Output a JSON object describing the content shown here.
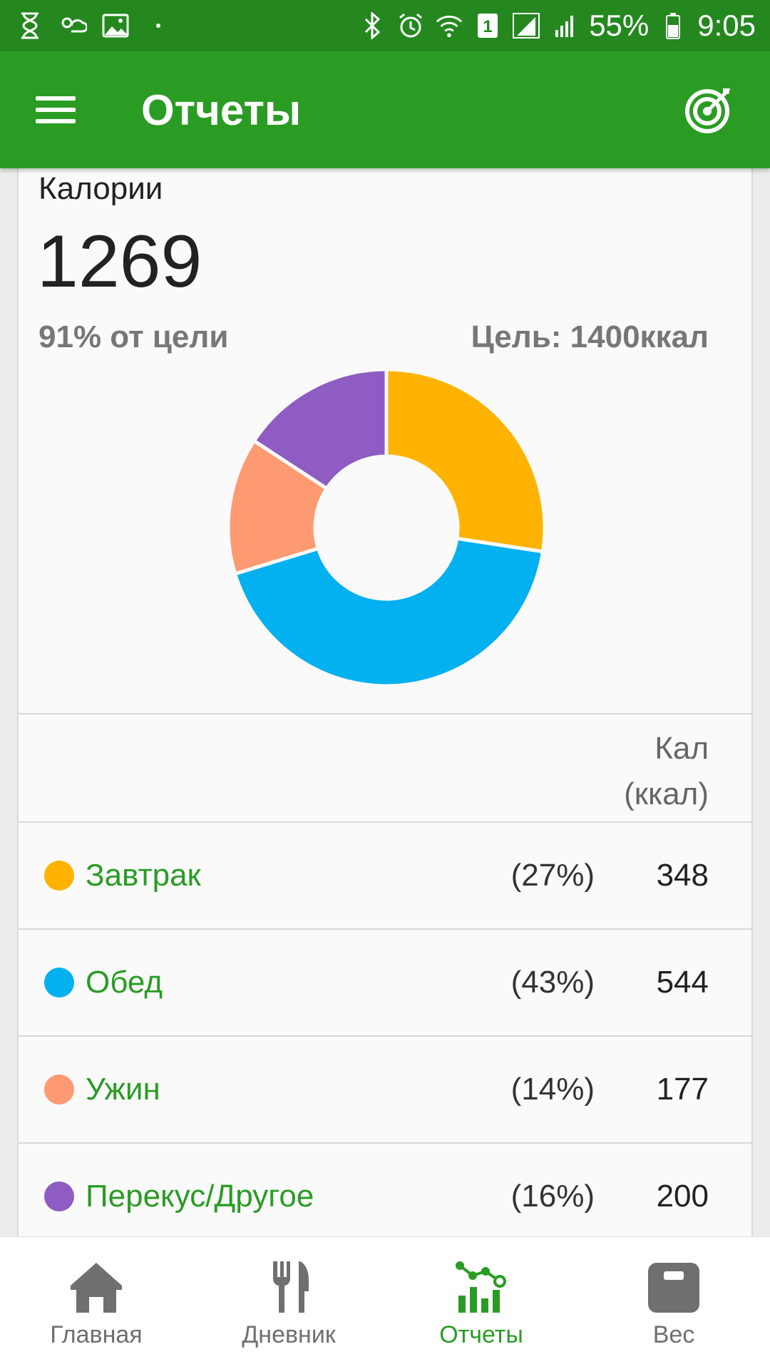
{
  "status_bar": {
    "battery": "55%",
    "time": "9:05",
    "sim_badge": "1"
  },
  "app_bar": {
    "title": "Отчеты",
    "menu_icon": "hamburger-icon",
    "goal_icon": "target-icon"
  },
  "calories": {
    "label": "Калории",
    "total": "1269",
    "percent_of_goal": "91% от цели",
    "goal": "Цель: 1400ккал"
  },
  "table": {
    "header_line1": "Кал",
    "header_line2": "(ккал)",
    "rows": [
      {
        "name": "Завтрак",
        "percent": "(27%)",
        "value": "348",
        "color": "#ffb300"
      },
      {
        "name": "Обед",
        "percent": "(43%)",
        "value": "544",
        "color": "#03b0f0"
      },
      {
        "name": "Ужин",
        "percent": "(14%)",
        "value": "177",
        "color": "#fe9a72"
      },
      {
        "name": "Перекус/Другое",
        "percent": "(16%)",
        "value": "200",
        "color": "#8e5cc2"
      }
    ]
  },
  "chart_data": {
    "type": "pie",
    "categories": [
      "Завтрак",
      "Обед",
      "Ужин",
      "Перекус/Другое"
    ],
    "values": [
      348,
      544,
      177,
      200
    ],
    "colors": [
      "#ffb300",
      "#03b0f0",
      "#fe9a72",
      "#8e5cc2"
    ],
    "donut": true
  },
  "bottom_nav": {
    "items": [
      {
        "label": "Главная",
        "icon": "home-icon"
      },
      {
        "label": "Дневник",
        "icon": "fork-knife-icon"
      },
      {
        "label": "Отчеты",
        "icon": "reports-chart-icon",
        "active": true
      },
      {
        "label": "Вес",
        "icon": "scale-icon"
      }
    ]
  },
  "theme": {
    "primary": "#2a9c24",
    "status_bar": "#24881f"
  }
}
